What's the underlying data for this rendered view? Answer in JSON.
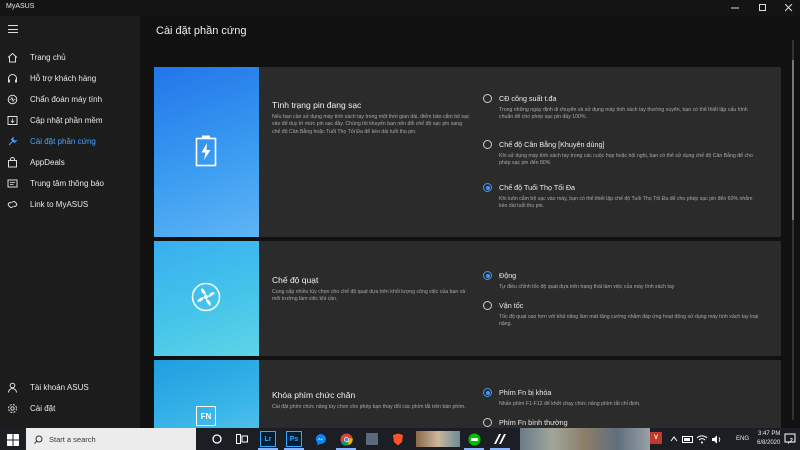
{
  "window": {
    "title": "MyASUS",
    "controls": [
      "minimize-icon",
      "maximize-icon",
      "close-icon"
    ]
  },
  "sidebar": {
    "items": [
      {
        "label": "Trang chủ",
        "icon": "home-icon"
      },
      {
        "label": "Hỗ trợ khách hàng",
        "icon": "headset-icon"
      },
      {
        "label": "Chẩn đoán máy tính",
        "icon": "diagnosis-icon"
      },
      {
        "label": "Cập nhật phần mềm",
        "icon": "update-icon"
      },
      {
        "label": "Cài đặt phần cứng",
        "icon": "hardware-settings-icon",
        "active": true
      },
      {
        "label": "AppDeals",
        "icon": "bag-icon"
      },
      {
        "label": "Trung tâm thông báo",
        "icon": "notification-icon"
      },
      {
        "label": "Link to MyASUS",
        "icon": "link-icon"
      }
    ],
    "bottom": [
      {
        "label": "Tài khoản ASUS",
        "icon": "account-icon"
      },
      {
        "label": "Cài đặt",
        "icon": "settings-icon"
      }
    ]
  },
  "main": {
    "title": "Cài đặt phần cứng",
    "cards": [
      {
        "title": "Tình trạng pin đang sạc",
        "desc": "Nếu bạn cần sử dụng máy tính xách tay trong một thời gian dài, điểm bảo cắm bộ sạc vào để duy trì mức pin sạc đầy. Chúng tôi khuyến bạn nên đổi chế độ sạc pin sang chế độ Cân Bằng hoặc Tuổi Thọ Tối Đa để kéo dài tuổi thọ pin.",
        "icon": "battery-charging-icon",
        "options": [
          {
            "label": "CĐ công suất t.đa",
            "desc": "Trong những ngày định di chuyển và sử dụng máy tính xách tay thường xuyên, bạn có thể thiết lập cấu hình chuẩn để cho phép sạc pin đầy 100%.",
            "selected": false
          },
          {
            "label": "Chế độ Cân Bằng [Khuyên dùng]",
            "desc": "Khi sử dụng máy tính xách tay trong các cuộc họp hoặc hội nghị, bạn có thể sử dụng chế độ Cân Bằng để cho phép sạc pin đến 80%",
            "selected": false
          },
          {
            "label": "Chế độ Tuổi Thọ Tối Đa",
            "desc": "Khi luôn cắm bộ sạc vào máy, bạn có thể thiết lập chế độ Tuổi Thọ Tối Đa để cho phép sạc pin đến 60% nhằm kéo dài tuổi thọ pin.",
            "selected": true
          }
        ]
      },
      {
        "title": "Chế độ quạt",
        "desc": "Cung cấp nhiều tùy chọn cho chế độ quạt dựa trên khối lượng công việc của bạn và môi trường làm việc khi cần.",
        "icon": "fan-icon",
        "options": [
          {
            "label": "Động",
            "desc": "Tự điều chỉnh tốc độ quạt dựa trên trạng thái làm việc của máy tính xách tay",
            "selected": true
          },
          {
            "label": "Vận tốc",
            "desc": "Tốc độ quạt cao hơn với khả năng làm mát tăng cường nhằm đáp ứng hoạt động sử dụng máy tính xách tay loại nặng.",
            "selected": false
          }
        ]
      },
      {
        "title": "Khóa phím chức chăn",
        "desc": "Cài đặt phím chức năng tùy chọn cho phép bạn thay đổi các phím tắt trên bàn phím.",
        "icon": "fn-key-icon",
        "icon_text": "FN",
        "options": [
          {
            "label": "Phím Fn bị khóa",
            "desc": "Nhấn phím F1-F12 để khởi chạy chức năng phím tắt chỉ định.",
            "selected": true
          },
          {
            "label": "Phím Fn bình thường",
            "desc": "",
            "selected": false
          }
        ]
      }
    ]
  },
  "taskbar": {
    "search_placeholder": "Start a search",
    "apps": [
      "cortana-icon",
      "task-view-icon",
      "lightroom-icon",
      "photoshop-icon",
      "messenger-icon",
      "chrome-icon",
      "brave-icon",
      "photo-icon",
      "app-icon",
      "line-icon",
      "asus-icon"
    ],
    "lightroom_label": "Lr",
    "photoshop_label": "Ps",
    "language": "ENG",
    "time": "3:47 PM",
    "date": "6/8/2020",
    "notification_count": "2"
  }
}
